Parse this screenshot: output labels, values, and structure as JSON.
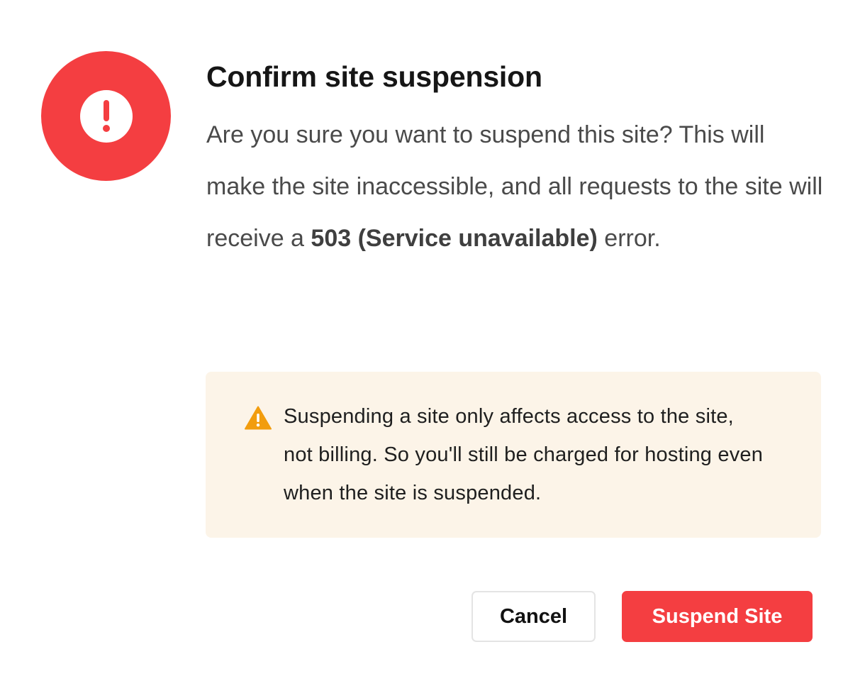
{
  "dialog": {
    "title": "Confirm site suspension",
    "description": {
      "before": "Are you sure you want to suspend this site? This will make the site inaccessible, and all requests to the site will receive a ",
      "emphasis": "503 (Service unavailable)",
      "after": " error."
    },
    "icon": "exclamation-circle-icon",
    "warning": {
      "icon": "warning-triangle-icon",
      "text": "Suspending a site only affects access to the site, not billing. So you'll still be charged for hosting even when the site is suspended."
    },
    "buttons": {
      "cancel_label": "Cancel",
      "confirm_label": "Suspend Site"
    }
  },
  "colors": {
    "danger": "#f43e41",
    "warning_icon": "#f29d0e",
    "warning_background": "#fcf4e8",
    "title": "#161616",
    "body_text": "#4a4a4a"
  }
}
